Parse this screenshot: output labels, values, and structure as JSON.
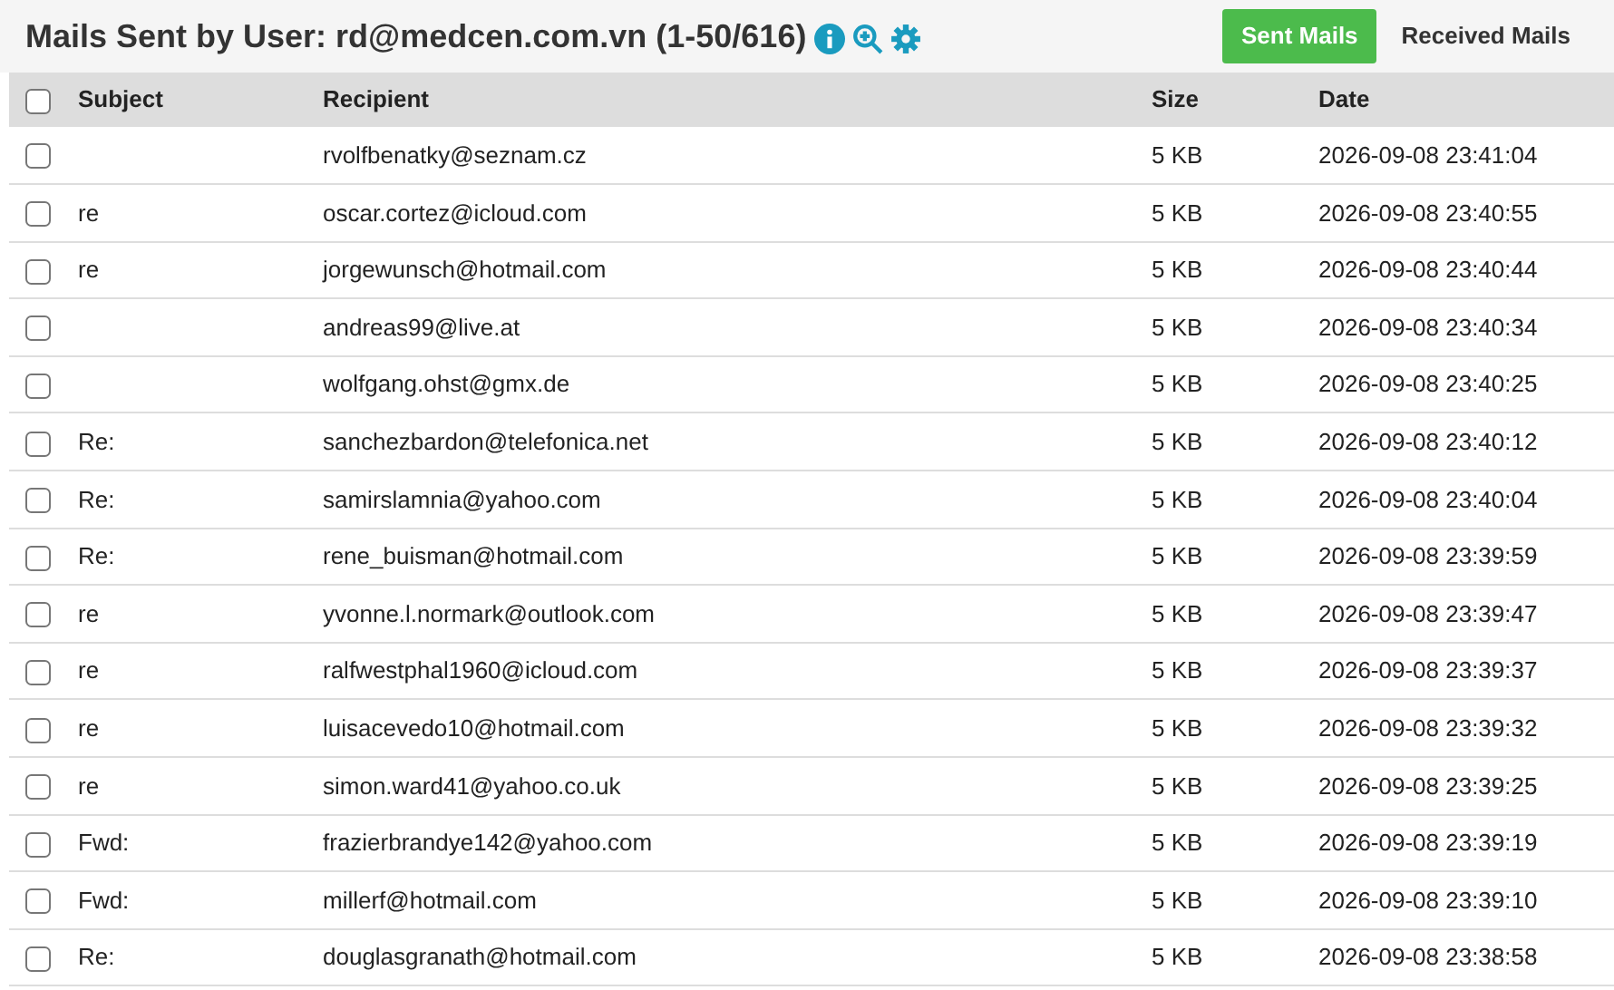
{
  "header": {
    "title": "Mails Sent by User: rd@medcen.com.vn (1-50/616)",
    "tabs": [
      {
        "label": "Sent Mails",
        "selected": true
      },
      {
        "label": "Received Mails",
        "selected": false
      }
    ]
  },
  "table": {
    "select_all": {
      "checked": false
    },
    "columns": [
      "Subject",
      "Recipient",
      "Size",
      "Date"
    ],
    "rows": [
      {
        "checked": false,
        "recipient": "rvolfbenatky@seznam.cz",
        "size": "5 KB",
        "date": "2026-09-08 23:41:04"
      },
      {
        "checked": false,
        "subject": "re",
        "recipient": "oscar.cortez@icloud.com",
        "size": "5 KB",
        "date": "2026-09-08 23:40:55"
      },
      {
        "checked": false,
        "subject": "re",
        "recipient": "jorgewunsch@hotmail.com",
        "size": "5 KB",
        "date": "2026-09-08 23:40:44"
      },
      {
        "checked": false,
        "recipient": "andreas99@live.at",
        "size": "5 KB",
        "date": "2026-09-08 23:40:34"
      },
      {
        "checked": false,
        "recipient": "wolfgang.ohst@gmx.de",
        "size": "5 KB",
        "date": "2026-09-08 23:40:25"
      },
      {
        "checked": false,
        "subject": "Re:",
        "recipient": "sanchezbardon@telefonica.net",
        "size": "5 KB",
        "date": "2026-09-08 23:40:12"
      },
      {
        "checked": false,
        "subject": "Re:",
        "recipient": "samirslamnia@yahoo.com",
        "size": "5 KB",
        "date": "2026-09-08 23:40:04"
      },
      {
        "checked": false,
        "subject": "Re:",
        "recipient": "rene_buisman@hotmail.com",
        "size": "5 KB",
        "date": "2026-09-08 23:39:59"
      },
      {
        "checked": false,
        "subject": "re",
        "recipient": "yvonne.l.normark@outlook.com",
        "size": "5 KB",
        "date": "2026-09-08 23:39:47"
      },
      {
        "checked": false,
        "subject": "re",
        "recipient": "ralfwestphal1960@icloud.com",
        "size": "5 KB",
        "date": "2026-09-08 23:39:37"
      },
      {
        "checked": false,
        "subject": "re",
        "recipient": "luisacevedo10@hotmail.com",
        "size": "5 KB",
        "date": "2026-09-08 23:39:32"
      },
      {
        "checked": false,
        "subject": "re",
        "recipient": "simon.ward41@yahoo.co.uk",
        "size": "5 KB",
        "date": "2026-09-08 23:39:25"
      },
      {
        "checked": false,
        "subject": "Fwd:",
        "recipient": "frazierbrandye142@yahoo.com",
        "size": "5 KB",
        "date": "2026-09-08 23:39:19"
      },
      {
        "checked": false,
        "subject": "Fwd:",
        "recipient": "millerf@hotmail.com",
        "size": "5 KB",
        "date": "2026-09-08 23:39:10"
      },
      {
        "checked": false,
        "subject": "Re:",
        "recipient": "douglasgranath@hotmail.com",
        "size": "5 KB",
        "date": "2026-09-08 23:38:58"
      }
    ]
  }
}
